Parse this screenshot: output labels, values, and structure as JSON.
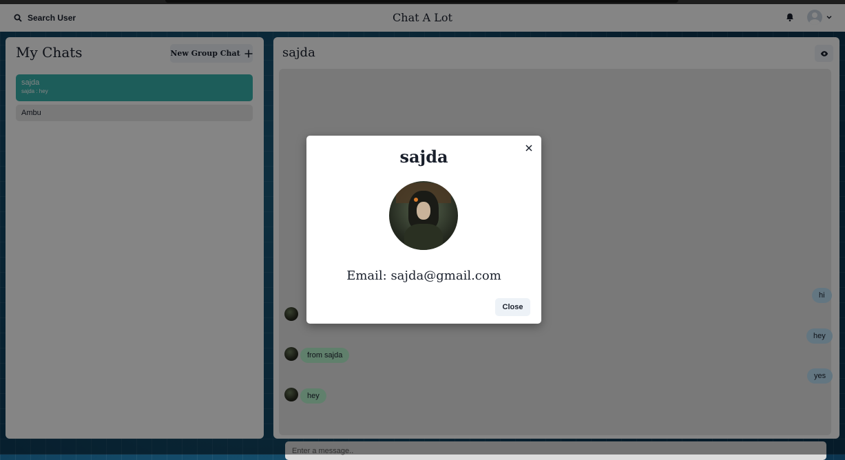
{
  "header": {
    "search_label": "Search User",
    "app_title": "Chat A Lot"
  },
  "sidebar": {
    "title": "My Chats",
    "new_group_label": "New Group Chat",
    "chats": [
      {
        "name": "sajda",
        "latest": "sajda : hey",
        "active": true
      },
      {
        "name": "Ambu",
        "latest": "",
        "active": false
      }
    ]
  },
  "chat": {
    "title": "sajda",
    "messages": [
      {
        "text": "hi",
        "sender": "me"
      },
      {
        "text": "hey",
        "sender": "me"
      },
      {
        "text": "from sajda",
        "sender": "sajda"
      },
      {
        "text": "yes",
        "sender": "me"
      },
      {
        "text": "hey",
        "sender": "sajda"
      }
    ],
    "input_placeholder": "Enter a message.."
  },
  "modal": {
    "name": "sajda",
    "email_text": "Email: sajda@gmail.com",
    "close_label": "Close"
  },
  "colors": {
    "accent_active_chat": "#38b2ac",
    "my_bubble": "#bee3f8",
    "their_bubble": "#b9f5d0"
  }
}
